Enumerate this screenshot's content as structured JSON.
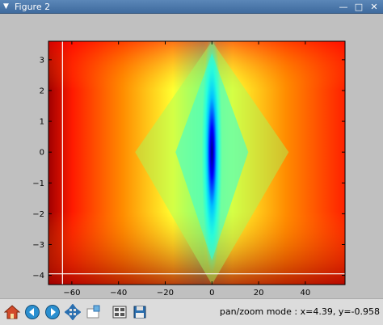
{
  "window": {
    "title": "Figure 2",
    "menu_glyph": "▼",
    "minimize_glyph": "—",
    "maximize_glyph": "□",
    "close_glyph": "✕"
  },
  "toolbar": {
    "buttons": [
      {
        "name": "home-icon"
      },
      {
        "name": "back-icon"
      },
      {
        "name": "forward-icon"
      },
      {
        "name": "pan-icon"
      },
      {
        "name": "zoom-icon"
      },
      {
        "name": "subplots-icon"
      },
      {
        "name": "save-icon"
      }
    ],
    "status": "pan/zoom mode : x=4.39, y=-0.958"
  },
  "chart_data": {
    "type": "heatmap",
    "colormap": "jet",
    "xlim": [
      -70,
      57
    ],
    "ylim": [
      -4.3,
      3.6
    ],
    "x_ticks": [
      "−60",
      "−40",
      "−20",
      "0",
      "20",
      "40"
    ],
    "x_tick_values": [
      -60,
      -40,
      -20,
      0,
      20,
      40
    ],
    "y_ticks": [
      "3",
      "2",
      "1",
      "0",
      "−1",
      "−2",
      "−3",
      "−4"
    ],
    "y_tick_values": [
      3,
      2,
      1,
      0,
      -1,
      -2,
      -3,
      -4
    ],
    "crosshair": {
      "x": -64,
      "y": -3.95,
      "color": "#ffffff"
    },
    "description": "value increases with distance from x=0 axis, minimum (blue) along x=0 centered at y=0"
  }
}
